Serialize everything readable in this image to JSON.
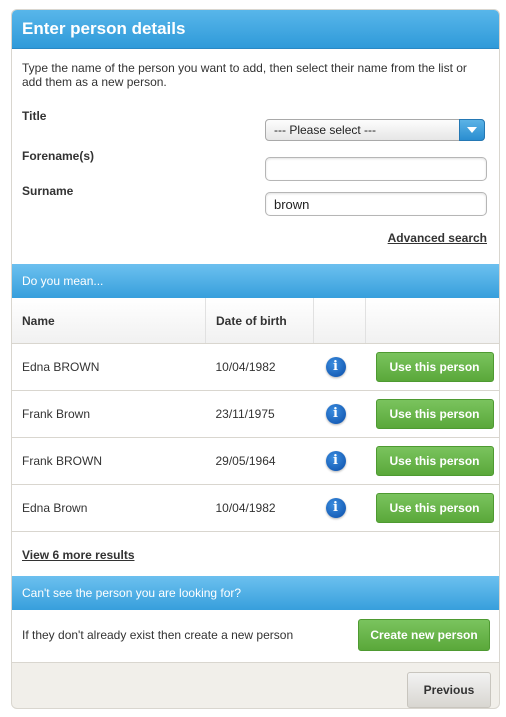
{
  "header": {
    "title": "Enter person details"
  },
  "intro": {
    "text": "Type the name of the person you want to add, then select their name from the list or add them as a new person."
  },
  "form": {
    "title_label": "Title",
    "title_selected": "--- Please select ---",
    "forename_label": "Forename(s)",
    "forename_value": "",
    "surname_label": "Surname",
    "surname_value": "brown",
    "advanced_search": "Advanced search"
  },
  "suggestions": {
    "heading": "Do you mean...",
    "columns": [
      "Name",
      "Date of birth",
      "",
      ""
    ],
    "rows": [
      {
        "name": "Edna BROWN",
        "dob": "10/04/1982",
        "info": "i",
        "action": "Use this person"
      },
      {
        "name": "Frank Brown",
        "dob": "23/11/1975",
        "info": "i",
        "action": "Use this person"
      },
      {
        "name": "Frank BROWN",
        "dob": "29/05/1964",
        "info": "i",
        "action": "Use this person"
      },
      {
        "name": "Edna Brown",
        "dob": "10/04/1982",
        "info": "i",
        "action": "Use this person"
      }
    ],
    "more_results": "View 6 more results"
  },
  "create": {
    "heading": "Can't see the person you are looking for?",
    "text": "If they don't already exist then create a new person",
    "button": "Create new person"
  },
  "footer": {
    "previous": "Previous"
  },
  "colors": {
    "accent_blue": "#2f9ad9",
    "action_green": "#5aa83a"
  }
}
